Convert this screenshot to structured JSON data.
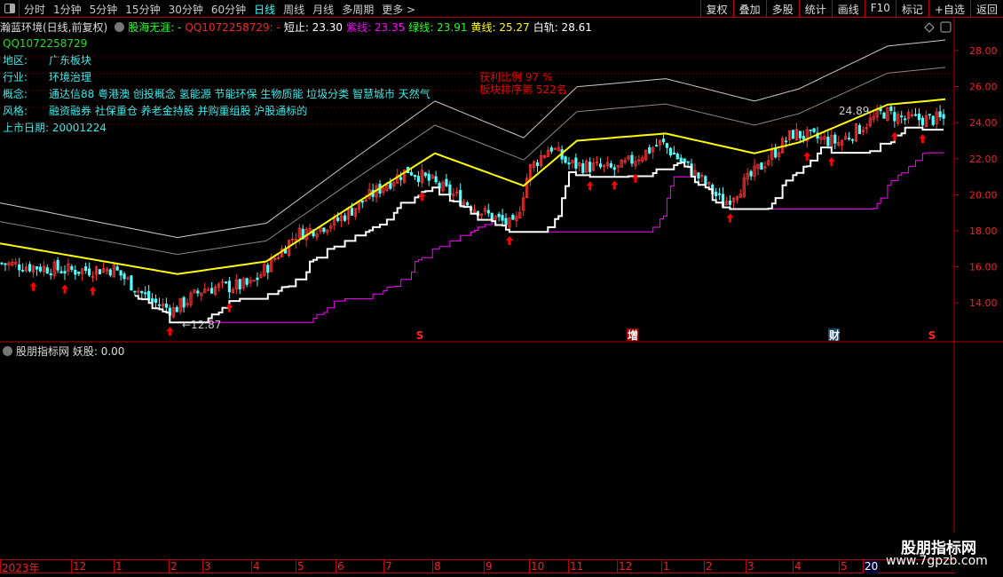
{
  "toolbar": {
    "periods": [
      "分时",
      "1分钟",
      "5分钟",
      "15分钟",
      "30分钟",
      "60分钟",
      "日线",
      "周线",
      "月线",
      "多周期",
      "更多 >"
    ],
    "active": "日线",
    "tools": [
      "复权",
      "叠加",
      "多股",
      "统计",
      "画线",
      "F10",
      "标记",
      "+自选",
      "返回"
    ]
  },
  "info": {
    "stock": "瀚蓝环境(日线,前复权)",
    "name1": "股海无涯: -",
    "name2": "QQ1072258729: -",
    "short_stop": "短止: 23.30",
    "purple": "紫线: 23.35",
    "green": "绿线: 23.91",
    "yellow": "黄线: 25.27",
    "white": "白轨: 28.61"
  },
  "f10": {
    "qq": "QQ1072258729",
    "rows": [
      {
        "k": "地区:",
        "v": "广东板块"
      },
      {
        "k": "行业:",
        "v": "环境治理"
      },
      {
        "k": "概念:",
        "v": "通达信88 粤港澳 创投概念 氢能源 节能环保 生物质能 垃圾分类 智慧城市 天然气"
      },
      {
        "k": "风格:",
        "v": "融资融券 社保重仓 养老金持股 并购重组股 沪股通标的"
      }
    ],
    "listing": "上市日期: 20001224"
  },
  "annotation": {
    "profit": "获利比例 97 %",
    "rank": "板块排序第 522名"
  },
  "sub": {
    "title": "股朋指标网",
    "value": "妖股: 0.00"
  },
  "watermark": {
    "name": "股朋指标网",
    "url": "www.7gpzb.com"
  },
  "colors": {
    "up": "#ff3232",
    "down": "#54ffff",
    "yellow": "#ffff00",
    "white": "#ffffff",
    "magenta": "#ff00ff",
    "grid": "#b00000"
  },
  "chart_data": {
    "type": "candlestick",
    "yticks": [
      "28.00",
      "26.00",
      "24.00",
      "22.00",
      "20.00",
      "18.00",
      "16.00",
      "14.00"
    ],
    "ylim": [
      12.3,
      29
    ],
    "x_labels": [
      "2023年",
      "12",
      "1",
      "2",
      "3",
      "4",
      "5",
      "6",
      "7",
      "8",
      "9",
      "10",
      "11",
      "12",
      "1",
      "2",
      "3",
      "4",
      "5",
      "20"
    ],
    "close_keypoints": [
      16.2,
      15.8,
      15.9,
      14.1,
      13.6,
      14.8,
      15.0,
      17.8,
      18.5,
      20.5,
      21.4,
      20.7,
      19.0,
      18.2,
      21.4,
      22.7,
      21.7,
      21.4,
      22.9,
      20.7,
      19.5,
      20.7,
      23.4,
      22.9,
      24.6,
      24.2,
      24.2
    ],
    "yellow_line": [
      17.3,
      15.6,
      16.3,
      19.5,
      22.3,
      20.5,
      23.0,
      23.4,
      22.3,
      22.9,
      25.0,
      25.3
    ],
    "high_label": "24.89",
    "low_label": "12.87",
    "event_markers": [
      "S",
      "增",
      "财",
      "S"
    ]
  }
}
